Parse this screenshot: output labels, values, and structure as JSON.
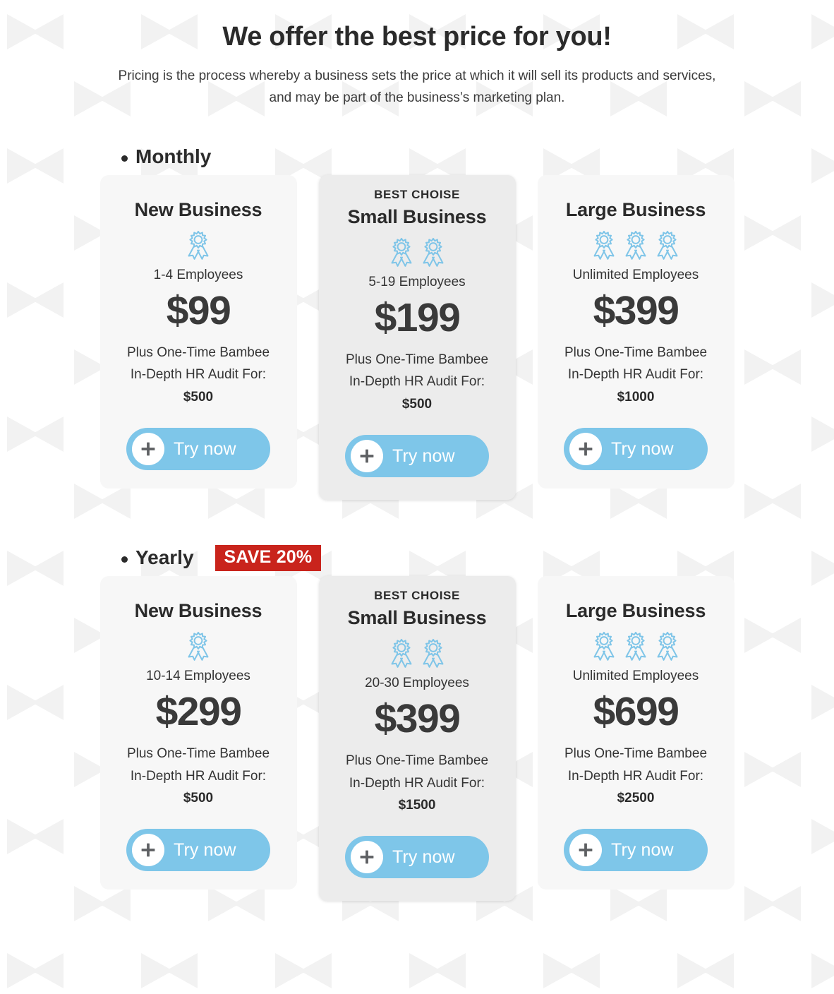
{
  "header": {
    "title": "We offer the best price for you!",
    "subtitle": "Pricing is the process whereby a business sets the price at which it will sell its products and services, and may be part of the business’s marketing plan."
  },
  "colors": {
    "accent_blue": "#7ec6e9",
    "badge_red": "#c9241c",
    "card_bg": "#f7f7f7",
    "card_bg_featured": "#ececec",
    "text_dark": "#2b2b2b"
  },
  "icons": {
    "ribbon": "award-ribbon-icon",
    "plus": "plus-icon",
    "bullet": "bullet-dot-icon"
  },
  "sections": [
    {
      "label": "Monthly",
      "badge": null,
      "plans": [
        {
          "best_tag": null,
          "title": "New Business",
          "ribbon_count": 1,
          "employees": "1-4 Employees",
          "price": "$99",
          "audit_line1": "Plus One-Time Bambee",
          "audit_line2": "In-Depth HR Audit For:",
          "audit_price": "$500",
          "cta": "Try now"
        },
        {
          "best_tag": "BEST CHOISE",
          "title": "Small Business",
          "ribbon_count": 2,
          "employees": "5-19 Employees",
          "price": "$199",
          "audit_line1": "Plus One-Time Bambee",
          "audit_line2": "In-Depth HR Audit For:",
          "audit_price": "$500",
          "cta": "Try now"
        },
        {
          "best_tag": null,
          "title": "Large Business",
          "ribbon_count": 3,
          "employees": "Unlimited Employees",
          "price": "$399",
          "audit_line1": "Plus One-Time Bambee",
          "audit_line2": "In-Depth HR Audit For:",
          "audit_price": "$1000",
          "cta": "Try now"
        }
      ]
    },
    {
      "label": "Yearly",
      "badge": "SAVE 20%",
      "plans": [
        {
          "best_tag": null,
          "title": "New Business",
          "ribbon_count": 1,
          "employees": "10-14 Employees",
          "price": "$299",
          "audit_line1": "Plus One-Time Bambee",
          "audit_line2": "In-Depth HR Audit For:",
          "audit_price": "$500",
          "cta": "Try now"
        },
        {
          "best_tag": "BEST CHOISE",
          "title": "Small Business",
          "ribbon_count": 2,
          "employees": "20-30 Employees",
          "price": "$399",
          "audit_line1": "Plus One-Time Bambee",
          "audit_line2": "In-Depth HR Audit For:",
          "audit_price": "$1500",
          "cta": "Try now"
        },
        {
          "best_tag": null,
          "title": "Large Business",
          "ribbon_count": 3,
          "employees": "Unlimited Employees",
          "price": "$699",
          "audit_line1": "Plus One-Time Bambee",
          "audit_line2": "In-Depth HR Audit For:",
          "audit_price": "$2500",
          "cta": "Try now"
        }
      ]
    }
  ]
}
